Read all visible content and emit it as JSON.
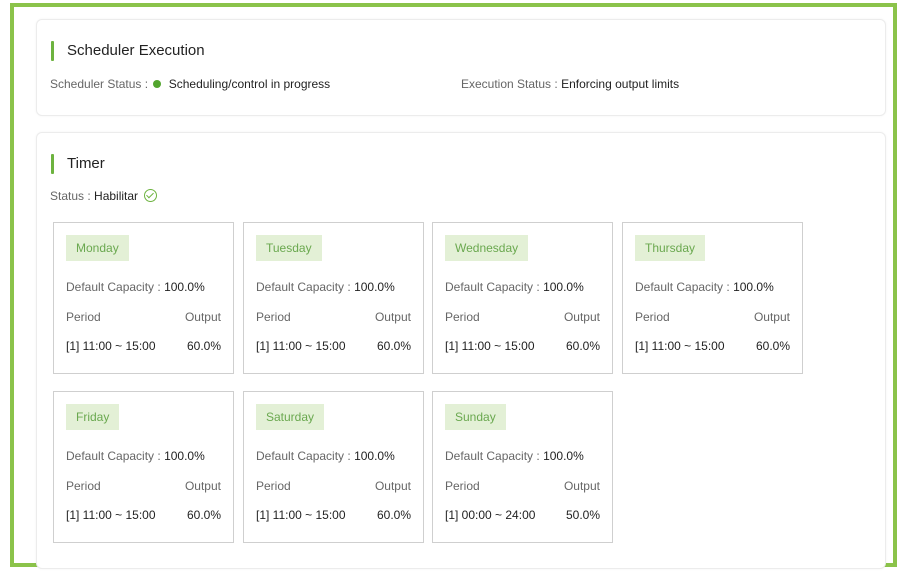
{
  "scheduler": {
    "title": "Scheduler Execution",
    "status_label": "Scheduler Status :",
    "status_value": "Scheduling/control in progress",
    "status_color": "#52a52e",
    "execution_label": "Execution Status :",
    "execution_value": "Enforcing output limits"
  },
  "timer": {
    "title": "Timer",
    "status_label": "Status :",
    "status_value": "Habilitar",
    "days": [
      {
        "name": "Monday",
        "capacity_label": "Default Capacity :",
        "capacity": "100.0%",
        "period_label": "Period",
        "output_label": "Output",
        "period": "[1] 11:00 ~ 15:00",
        "output": "60.0%"
      },
      {
        "name": "Tuesday",
        "capacity_label": "Default Capacity :",
        "capacity": "100.0%",
        "period_label": "Period",
        "output_label": "Output",
        "period": "[1] 11:00 ~ 15:00",
        "output": "60.0%"
      },
      {
        "name": "Wednesday",
        "capacity_label": "Default Capacity :",
        "capacity": "100.0%",
        "period_label": "Period",
        "output_label": "Output",
        "period": "[1] 11:00 ~ 15:00",
        "output": "60.0%"
      },
      {
        "name": "Thursday",
        "capacity_label": "Default Capacity :",
        "capacity": "100.0%",
        "period_label": "Period",
        "output_label": "Output",
        "period": "[1] 11:00 ~ 15:00",
        "output": "60.0%"
      },
      {
        "name": "Friday",
        "capacity_label": "Default Capacity :",
        "capacity": "100.0%",
        "period_label": "Period",
        "output_label": "Output",
        "period": "[1] 11:00 ~ 15:00",
        "output": "60.0%"
      },
      {
        "name": "Saturday",
        "capacity_label": "Default Capacity :",
        "capacity": "100.0%",
        "period_label": "Period",
        "output_label": "Output",
        "period": "[1] 11:00 ~ 15:00",
        "output": "60.0%"
      },
      {
        "name": "Sunday",
        "capacity_label": "Default Capacity :",
        "capacity": "100.0%",
        "period_label": "Period",
        "output_label": "Output",
        "period": "[1] 00:00 ~ 24:00",
        "output": "50.0%"
      }
    ]
  },
  "colors": {
    "accent": "#6db33f",
    "frame": "#8bc34a",
    "day_tag_bg": "#e3f0d6"
  }
}
